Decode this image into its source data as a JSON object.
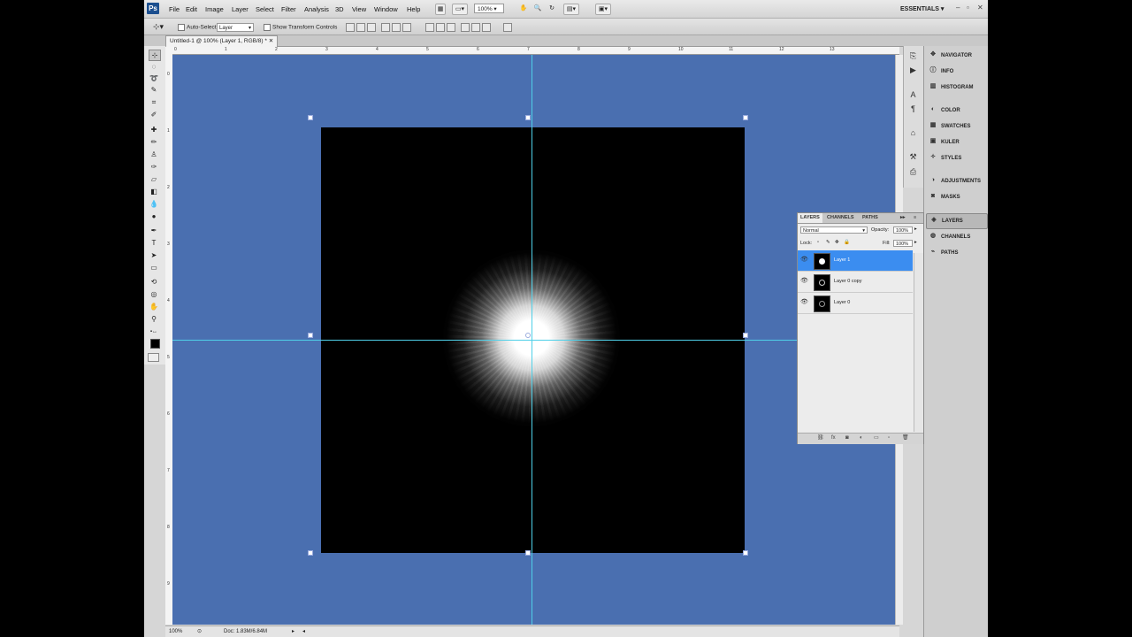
{
  "app": {
    "logo": "Ps",
    "workspace": "ESSENTIALS"
  },
  "menu": [
    "File",
    "Edit",
    "Image",
    "Layer",
    "Select",
    "Filter",
    "Analysis",
    "3D",
    "View",
    "Window",
    "Help"
  ],
  "toolbar": {
    "zoom": "100%"
  },
  "options": {
    "auto_select_label": "Auto-Select:",
    "auto_select_value": "Layer",
    "transform_label": "Show Transform Controls"
  },
  "document": {
    "tab_title": "Untitled-1 @ 100% (Layer 1, RGB/8) *"
  },
  "rulers": {
    "top": [
      "0",
      "1",
      "2",
      "3",
      "4",
      "5",
      "6",
      "7",
      "8",
      "9",
      "10",
      "11",
      "12",
      "13"
    ],
    "left": [
      "0",
      "1",
      "2",
      "3",
      "4",
      "5",
      "6",
      "7",
      "8",
      "9"
    ]
  },
  "status": {
    "zoom": "100%",
    "doc": "Doc: 1.83M/6.84M"
  },
  "dock": [
    "NAVIGATOR",
    "INFO",
    "HISTOGRAM",
    "COLOR",
    "SWATCHES",
    "KULER",
    "STYLES",
    "ADJUSTMENTS",
    "MASKS",
    "LAYERS",
    "CHANNELS",
    "PATHS"
  ],
  "layers_panel": {
    "tabs": [
      "LAYERS",
      "CHANNELS",
      "PATHS"
    ],
    "blend_mode": "Normal",
    "opacity_label": "Opacity:",
    "opacity_value": "100%",
    "lock_label": "Lock:",
    "fill_label": "Fill:",
    "fill_value": "100%",
    "layers": [
      {
        "name": "Layer 1",
        "selected": true
      },
      {
        "name": "Layer 0 copy",
        "selected": false
      },
      {
        "name": "Layer 0",
        "selected": false
      }
    ]
  },
  "colors": {
    "pasteboard": "#4a6fb0",
    "guide": "#4fd0e8",
    "selection": "#3b8df0"
  }
}
